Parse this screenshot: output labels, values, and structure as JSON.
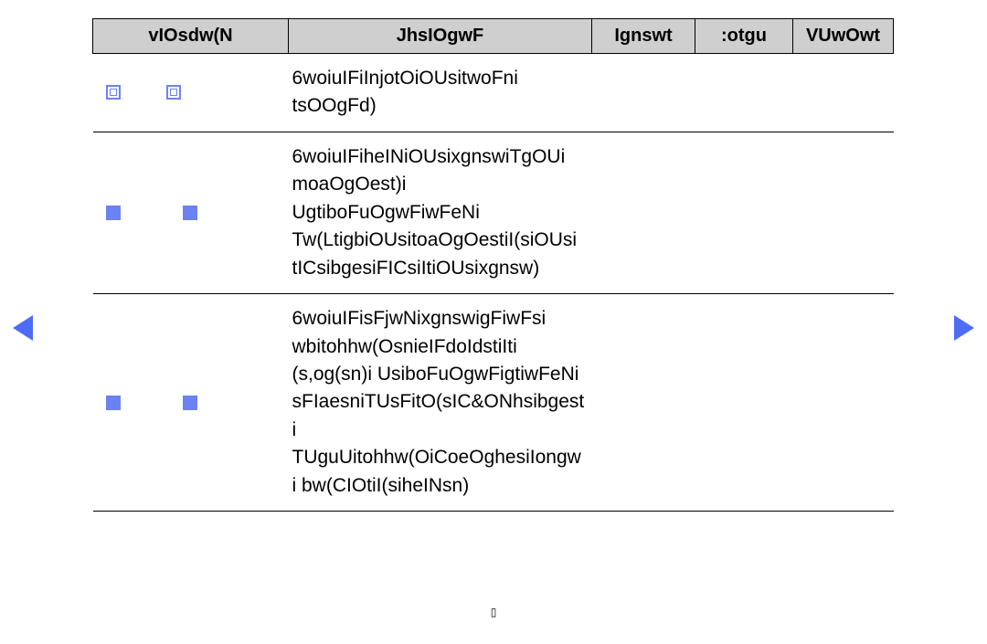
{
  "headers": [
    "vIOsdw(N",
    "JhsIOgwF",
    "Ignswt",
    ":otgu",
    "VUwOwt"
  ],
  "rows": [
    {
      "checkStyle": "outline",
      "gap": "normal",
      "desc": "6woiuIFiInjotOiOUsitwoFni tsOOgFd)"
    },
    {
      "checkStyle": "solid",
      "gap": "big",
      "desc": "6woiuIFiheINiOUsixgnswiTgOUi moaOgOest)i UgtiboFuOgwFiwFeNi Tw(LtigbiOUsitoaOgOestiI(siOUsi tICsibgesiFICsiItiOUsixgnsw)"
    },
    {
      "checkStyle": "solid",
      "gap": "big",
      "desc": "6woiuIFisFjwNixgnswigFiwFsi wbitohhw(OsnieIFdoIdstiIti (s,og(sn)i UsiboFuOgwFigtiwFeNi sFIaesniTUsFitO(sIC&ONhsibgesti TUguUitohhw(OiCoeOghesiIongwi bw(CIOtiI(siheINsn)"
    }
  ],
  "footer": "▯"
}
